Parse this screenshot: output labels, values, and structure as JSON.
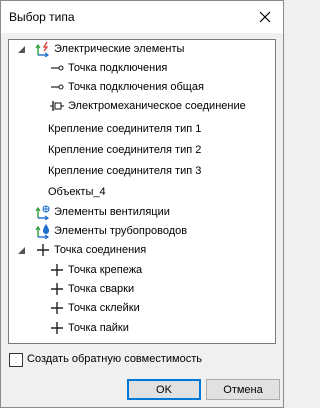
{
  "window": {
    "title": "Выбор типа"
  },
  "tree": {
    "items": [
      {
        "label": "Электрические элементы",
        "icon": "electric-elements-icon",
        "expander": "expanded"
      },
      {
        "label": "Точка подключения",
        "icon": "connection-point-icon"
      },
      {
        "label": "Точка подключения общая",
        "icon": "connection-point-common-icon"
      },
      {
        "label": "Электромеханическое соединение",
        "icon": "electromechanical-connection-icon"
      },
      {
        "label": "Крепление соединителя тип 1"
      },
      {
        "label": "Крепление соединителя тип 2"
      },
      {
        "label": "Крепление соединителя тип 3"
      },
      {
        "label": "Объекты_4"
      },
      {
        "label": "Элементы вентиляции",
        "icon": "ventilation-elements-icon"
      },
      {
        "label": "Элементы трубопроводов",
        "icon": "pipeline-elements-icon"
      },
      {
        "label": "Точка соединения",
        "icon": "plus-icon",
        "expander": "expanded"
      },
      {
        "label": "Точка крепежа",
        "icon": "plus-icon"
      },
      {
        "label": "Точка сварки",
        "icon": "plus-icon"
      },
      {
        "label": "Точка склейки",
        "icon": "plus-icon"
      },
      {
        "label": "Точка пайки",
        "icon": "plus-icon"
      }
    ]
  },
  "options": {
    "reverse_compat_label": "Создать обратную совместимость",
    "reverse_compat_checked": false
  },
  "buttons": {
    "ok": "OK",
    "cancel": "Отмена"
  },
  "colors": {
    "accent": "#0078d7",
    "icon_red": "#d33a2f",
    "icon_green": "#2e9e3a",
    "icon_blue": "#1e6fd0"
  }
}
